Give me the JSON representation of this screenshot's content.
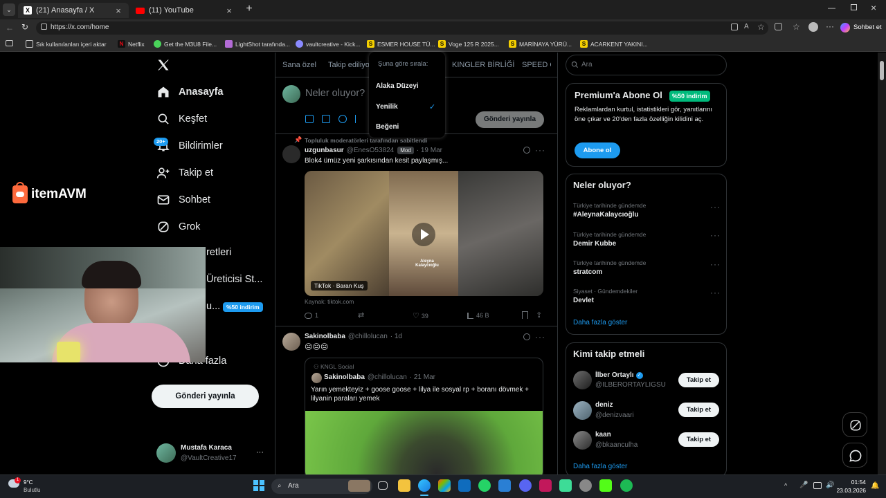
{
  "browser": {
    "tabs": [
      {
        "title": "(21) Anasayfa / X",
        "active": true
      },
      {
        "title": "(11) YouTube",
        "active": false
      }
    ],
    "url": "https://x.com/home",
    "profile_button": "Sohbet et",
    "bookmarks": [
      "Sık kullanılanları içeri aktar",
      "Netflix",
      "Get the M3U8 File...",
      "LightShot tarafında...",
      "vaultcreative - Kick...",
      "ESMER HOUSE TÜ...",
      "Voge 125 R 2025...",
      "MARİNAYA YÜRÜ...",
      "ACARKENT YAKINI..."
    ]
  },
  "overlay_logo": {
    "brand": "itemAVM"
  },
  "nav": {
    "items": [
      {
        "label": "Anasayfa"
      },
      {
        "label": "Keşfet"
      },
      {
        "label": "Bildirimler",
        "badge": "20+"
      },
      {
        "label": "Takip et"
      },
      {
        "label": "Sohbet"
      },
      {
        "label": "Grok"
      },
      {
        "label": "retleri"
      },
      {
        "label": "Üreticisi St..."
      },
      {
        "label": "u...",
        "badge": "%50 indirim"
      },
      {
        "label": "Daha fazla"
      }
    ],
    "post_button": "Gönderi yayınla",
    "account": {
      "name": "Mustafa Karaca",
      "handle": "@VaultCreative17"
    }
  },
  "feed": {
    "tabs": [
      "Sana özel",
      "Takip ediliyo",
      "KINGLER BİRLİĞİ",
      "SPEED G"
    ],
    "composer_placeholder": "Neler oluyor?",
    "composer_post": "Gönderi yayınla",
    "sort_menu": {
      "header": "Şuna göre sırala:",
      "options": [
        "Alaka Düzeyi",
        "Yenilik",
        "Beğeni"
      ],
      "selected": "Yenilik"
    },
    "posts": [
      {
        "pinned": "Topluluk moderatörleri tarafından sabitlendi",
        "name": "uzgunbasur",
        "handle": "@EnesO53824",
        "badge": "Mod",
        "date": "· 19 Mar",
        "text": "Blok4 ümüz yeni şarkısından kesit paylaşmış...",
        "media_label": "TikTok · Baran Kuş",
        "media_caption": "Aleyna Kalaycıoğlu",
        "source": "Kaynak: tiktok.com",
        "stats": {
          "replies": "1",
          "retweets": "",
          "likes": "39",
          "views": "46 B"
        }
      },
      {
        "name": "Sakinolbaba",
        "handle": "@chillolucan",
        "date": "· 1d",
        "text": "😑😑😑",
        "quote": {
          "community": "KNGL Social",
          "name": "Sakinolbaba",
          "handle": "@chillolucan",
          "date": "· 21 Mar",
          "text": "Yarın yemekteyiz + goose goose + lilya ile sosyal rp + boranı dövmek + lilyanin paraları yemek"
        }
      }
    ]
  },
  "sidebar": {
    "search_placeholder": "Ara",
    "premium": {
      "title": "Premium'a Abone Ol",
      "badge": "%50 indirim",
      "text": "Reklamlardan kurtul, istatistikleri gör, yanıtlarını öne çıkar ve 20'den fazla özelliğin kilidini aç.",
      "button": "Abone ol"
    },
    "trends": {
      "title": "Neler oluyor?",
      "items": [
        {
          "category": "Türkiye tarihinde gündemde",
          "name": "#AleynaKalaycıoğlu"
        },
        {
          "category": "Türkiye tarihinde gündemde",
          "name": "Demir Kubbe"
        },
        {
          "category": "Türkiye tarihinde gündemde",
          "name": "stratcom"
        },
        {
          "category": "Siyaset · Gündemdekiler",
          "name": "Devlet"
        }
      ],
      "more": "Daha fazla göster"
    },
    "who_to_follow": {
      "title": "Kimi takip etmeli",
      "items": [
        {
          "name": "İlber Ortaylı",
          "handle": "@ILBERORTAYLIGSU",
          "verified": true,
          "button": "Takip et"
        },
        {
          "name": "deniz",
          "handle": "@denizvaari",
          "button": "Takip et"
        },
        {
          "name": "kaan",
          "handle": "@bkaanculha",
          "button": "Takip et"
        }
      ],
      "more": "Daha fazla göster"
    }
  },
  "taskbar": {
    "weather_temp": "9°C",
    "weather_desc": "Bulutlu",
    "search": "Ara",
    "time": "01:54",
    "date": "23.03.2026"
  },
  "colors": {
    "accent": "#1d9bf0",
    "badge_green": "#00ba7c",
    "background": "#000000"
  }
}
